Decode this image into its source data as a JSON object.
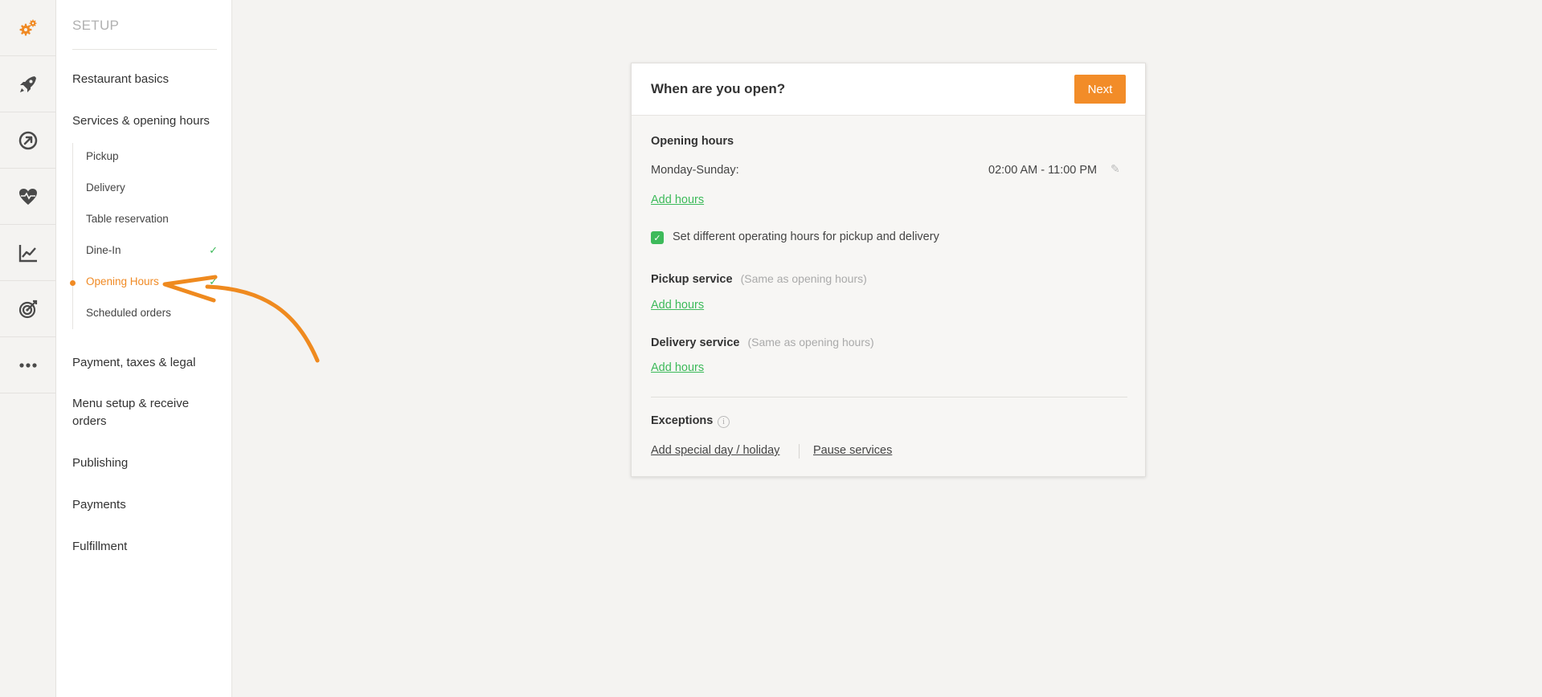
{
  "sidebar": {
    "title": "SETUP",
    "items": [
      {
        "label": "Restaurant basics"
      },
      {
        "label": "Services & opening hours"
      },
      {
        "label": "Payment, taxes & legal"
      },
      {
        "label": "Menu setup & receive orders"
      },
      {
        "label": "Publishing"
      },
      {
        "label": "Payments"
      },
      {
        "label": "Fulfillment"
      }
    ],
    "subitems": [
      {
        "label": "Pickup",
        "checked": false
      },
      {
        "label": "Delivery",
        "checked": false
      },
      {
        "label": "Table reservation",
        "checked": false
      },
      {
        "label": "Dine-In",
        "checked": true
      },
      {
        "label": "Opening Hours",
        "checked": true,
        "active": true
      },
      {
        "label": "Scheduled orders",
        "checked": false
      }
    ],
    "check_glyph": "✓"
  },
  "rail": {
    "icons": [
      "gear-icon",
      "rocket-icon",
      "compass-icon",
      "heart-icon",
      "chart-icon",
      "target-icon",
      "more-icon"
    ]
  },
  "card": {
    "title": "When are you open?",
    "next_label": "Next",
    "opening_hours": {
      "label": "Opening hours",
      "day_range": "Monday-Sunday:",
      "time_range": "02:00 AM - 11:00 PM",
      "add_hours": "Add hours"
    },
    "different_hours": {
      "checked": true,
      "label": "Set different operating hours for pickup and delivery",
      "check_glyph": "✓"
    },
    "pickup": {
      "label": "Pickup service",
      "hint": "(Same as opening hours)",
      "add_hours": "Add hours"
    },
    "delivery": {
      "label": "Delivery service",
      "hint": "(Same as opening hours)",
      "add_hours": "Add hours"
    },
    "exceptions": {
      "label": "Exceptions",
      "info_glyph": "i",
      "add_special_day": "Add special day / holiday",
      "pause_services": "Pause services"
    },
    "pencil_glyph": "✎"
  },
  "colors": {
    "accent": "#f08a24",
    "button": "#f28c28",
    "success": "#3dba5a"
  }
}
